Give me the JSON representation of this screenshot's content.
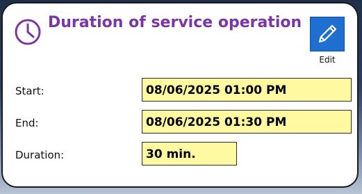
{
  "header": {
    "title": "Duration of service operation",
    "icon": "clock-icon",
    "title_color": "#7a35a6"
  },
  "toolbar": {
    "edit_label": "Edit",
    "edit_icon": "pencil-icon",
    "edit_color": "#1f6fd1"
  },
  "fields": {
    "start": {
      "label": "Start:",
      "value": "08/06/2025 01:00 PM"
    },
    "end": {
      "label": "End:",
      "value": "08/06/2025 01:30 PM"
    },
    "duration": {
      "label": "Duration:",
      "value": "30 min."
    }
  },
  "colors": {
    "value_background": "#fff9a2"
  }
}
